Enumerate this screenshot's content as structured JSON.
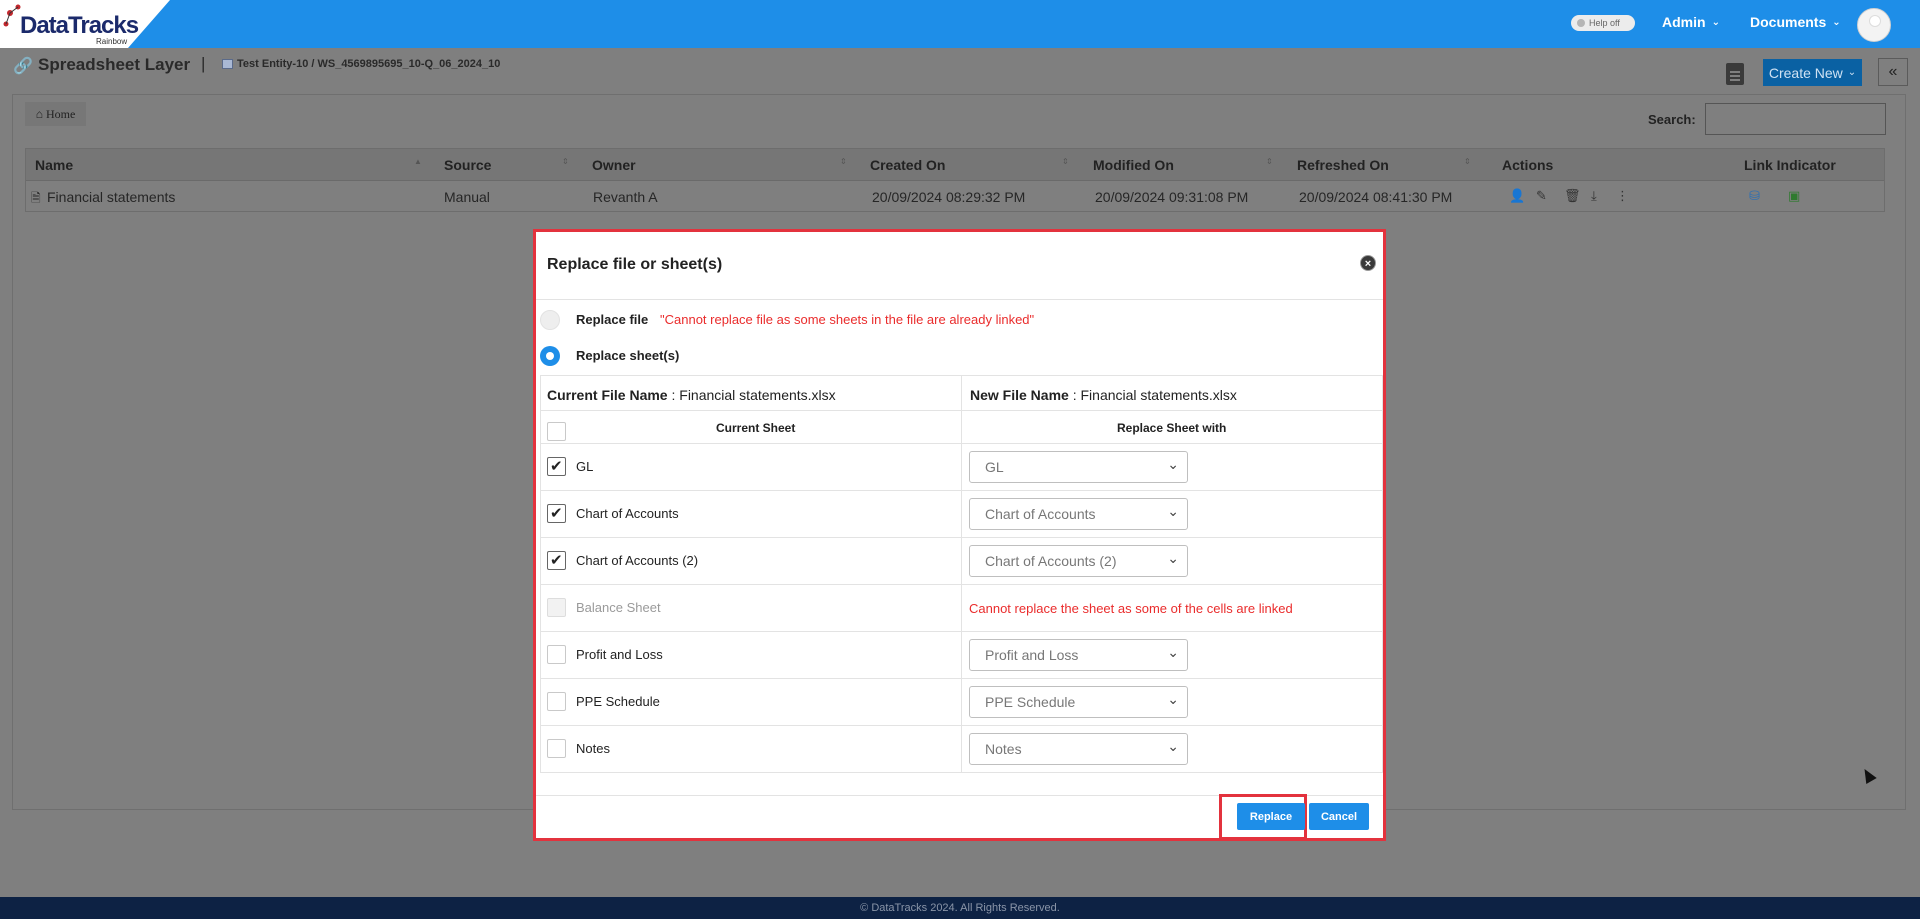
{
  "app": {
    "logo_text": "DataTracks",
    "logo_sub": "Rainbow",
    "help_toggle": "Help off",
    "menu_admin": "Admin",
    "menu_documents": "Documents"
  },
  "header": {
    "title": "Spreadsheet Layer",
    "separator": "|",
    "breadcrumb": "Test Entity-10 / WS_4569895695_10-Q_06_2024_10",
    "create_new": "Create New"
  },
  "toolbar": {
    "home": "Home",
    "search_label": "Search:"
  },
  "table": {
    "columns": [
      "Name",
      "Source",
      "Owner",
      "Created On",
      "Modified On",
      "Refreshed On",
      "Actions",
      "Link Indicator"
    ],
    "rows": [
      {
        "name": "Financial statements",
        "source": "Manual",
        "owner": "Revanth A",
        "created_on": "20/09/2024 08:29:32 PM",
        "modified_on": "20/09/2024 09:31:08 PM",
        "refreshed_on": "20/09/2024 08:41:30 PM"
      }
    ]
  },
  "modal": {
    "title": "Replace file or sheet(s)",
    "replace_file_label": "Replace file",
    "replace_file_error": "\"Cannot replace file as some sheets in the file are already linked\"",
    "replace_sheets_label": "Replace sheet(s)",
    "current_file_label": "Current File Name",
    "current_file_value": " : Financial statements.xlsx",
    "new_file_label": "New File Name",
    "new_file_value": " : Financial statements.xlsx",
    "col_current": "Current Sheet",
    "col_replace": "Replace Sheet with",
    "sheets": [
      {
        "name": "GL",
        "checked": true,
        "disabled": false,
        "replace_with": "GL"
      },
      {
        "name": "Chart of Accounts",
        "checked": true,
        "disabled": false,
        "replace_with": "Chart of Accounts"
      },
      {
        "name": "Chart of Accounts (2)",
        "checked": true,
        "disabled": false,
        "replace_with": "Chart of Accounts (2)"
      },
      {
        "name": "Balance Sheet",
        "checked": false,
        "disabled": true,
        "replace_with": "",
        "error": "Cannot replace the sheet as some of the cells are linked"
      },
      {
        "name": "Profit and Loss",
        "checked": false,
        "disabled": false,
        "replace_with": "Profit and Loss"
      },
      {
        "name": "PPE Schedule",
        "checked": false,
        "disabled": false,
        "replace_with": "PPE Schedule"
      },
      {
        "name": "Notes",
        "checked": false,
        "disabled": false,
        "replace_with": "Notes"
      }
    ],
    "replace_button": "Replace",
    "cancel_button": "Cancel"
  },
  "footer": {
    "text": "© DataTracks 2024. All Rights Reserved."
  }
}
